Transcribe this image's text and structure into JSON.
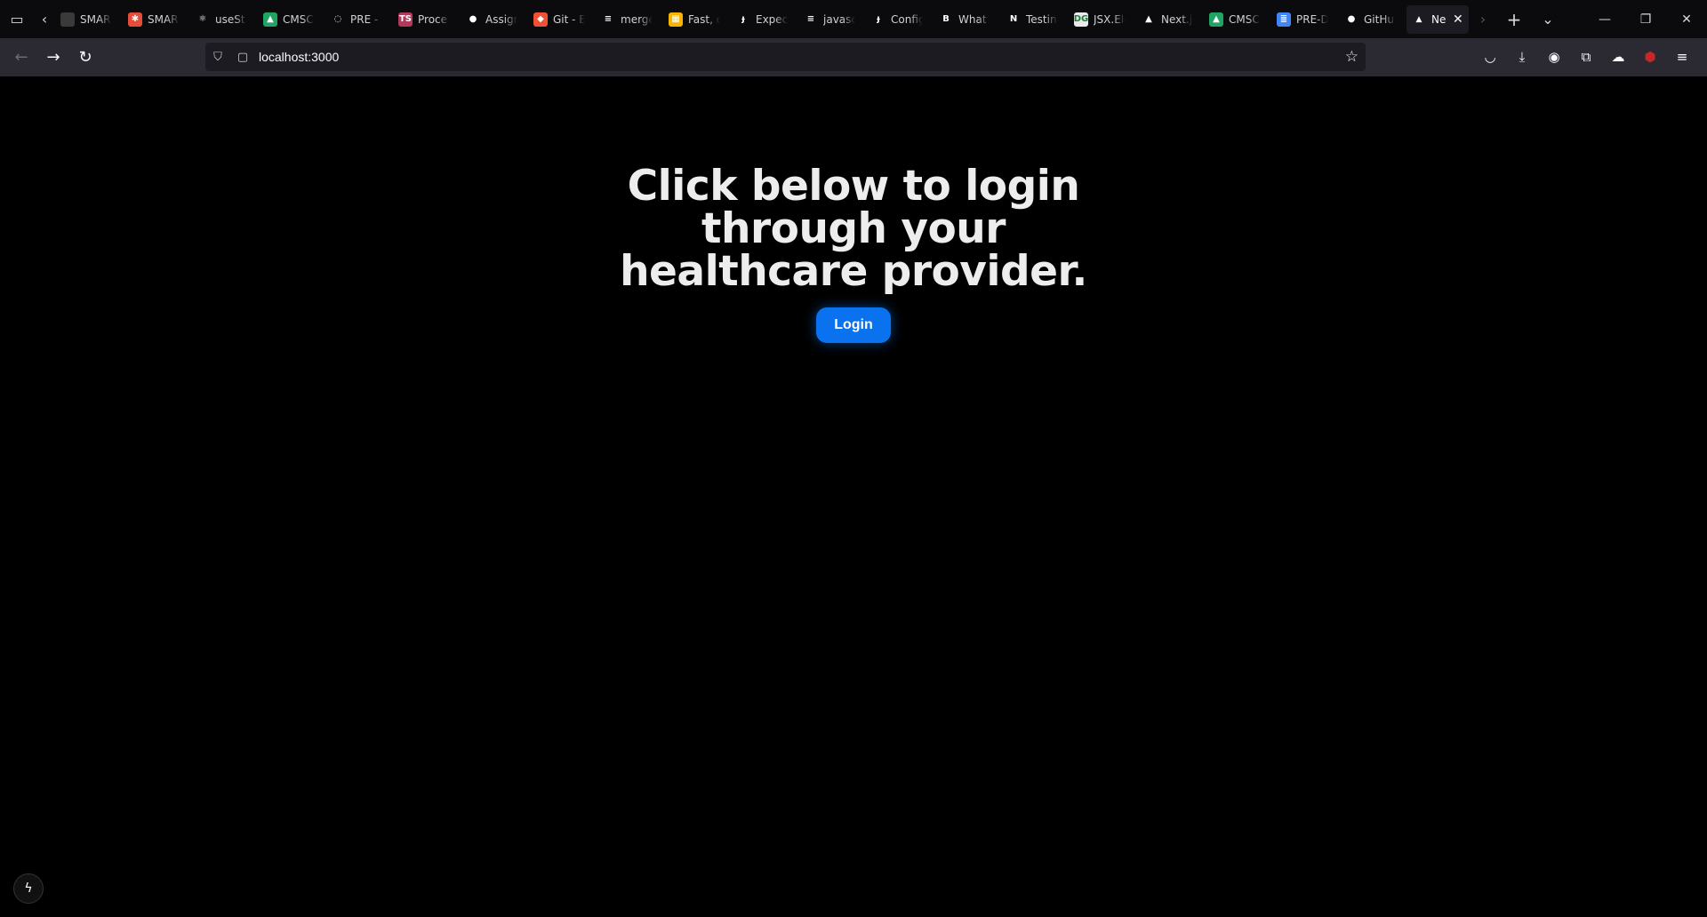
{
  "browser": {
    "tabs": [
      {
        "label": "SMAR",
        "favicon": "hm-icon",
        "color": "#3a3a3a",
        "glyph": ""
      },
      {
        "label": "SMAR",
        "favicon": "smart-icon",
        "color": "#e44d3a",
        "glyph": "✱"
      },
      {
        "label": "useSt",
        "favicon": "react-icon",
        "color": "#0b0b0e",
        "glyph": "⚛"
      },
      {
        "label": "CMSC",
        "favicon": "google-drive-icon",
        "color": "#1fa463",
        "glyph": "▲"
      },
      {
        "label": "PRE -",
        "favicon": "ring-icon",
        "color": "#0b0b0e",
        "glyph": "◌"
      },
      {
        "label": "Proce",
        "favicon": "ts-icon",
        "color": "#b03a5b",
        "glyph": "TS"
      },
      {
        "label": "Assign",
        "favicon": "github-icon",
        "color": "#0b0b0e",
        "glyph": "●"
      },
      {
        "label": "Git - E",
        "favicon": "git-icon",
        "color": "#f05033",
        "glyph": "◆"
      },
      {
        "label": "merge",
        "favicon": "stackoverflow-icon",
        "color": "#0b0b0e",
        "glyph": "≡"
      },
      {
        "label": "Fast, d",
        "favicon": "grid-icon",
        "color": "#f5b400",
        "glyph": "▦"
      },
      {
        "label": "Expect",
        "favicon": "jest-icon",
        "color": "#0b0b0e",
        "glyph": "ɟ"
      },
      {
        "label": "javasc",
        "favicon": "stackoverflow-icon",
        "color": "#0b0b0e",
        "glyph": "≡"
      },
      {
        "label": "Config",
        "favicon": "jest-icon",
        "color": "#0b0b0e",
        "glyph": "ɟ"
      },
      {
        "label": "What",
        "favicon": "babel-icon",
        "color": "#0b0b0e",
        "glyph": "B"
      },
      {
        "label": "Testin",
        "favicon": "next-icon",
        "color": "#0b0b0e",
        "glyph": "N"
      },
      {
        "label": "JSX.Ele",
        "favicon": "ts-icon",
        "color": "#eaeaea",
        "glyph": "DG"
      },
      {
        "label": "Next.js",
        "favicon": "vercel-icon",
        "color": "#0b0b0e",
        "glyph": "▲"
      },
      {
        "label": "CMSC",
        "favicon": "google-drive-icon",
        "color": "#1fa463",
        "glyph": "▲"
      },
      {
        "label": "PRE-D",
        "favicon": "google-docs-icon",
        "color": "#4285f4",
        "glyph": "≣"
      },
      {
        "label": "GitHu",
        "favicon": "github-icon",
        "color": "#0b0b0e",
        "glyph": "●"
      }
    ],
    "active_tab": {
      "label": "Ne",
      "favicon": "vercel-icon",
      "glyph": "▲"
    },
    "url": "localhost:3000"
  },
  "page": {
    "headline": "Click below to login through your healthcare provider.",
    "login_label": "Login"
  },
  "colors": {
    "page_bg": "#000000",
    "headline": "#ededed",
    "button_bg": "#0a72ef"
  }
}
